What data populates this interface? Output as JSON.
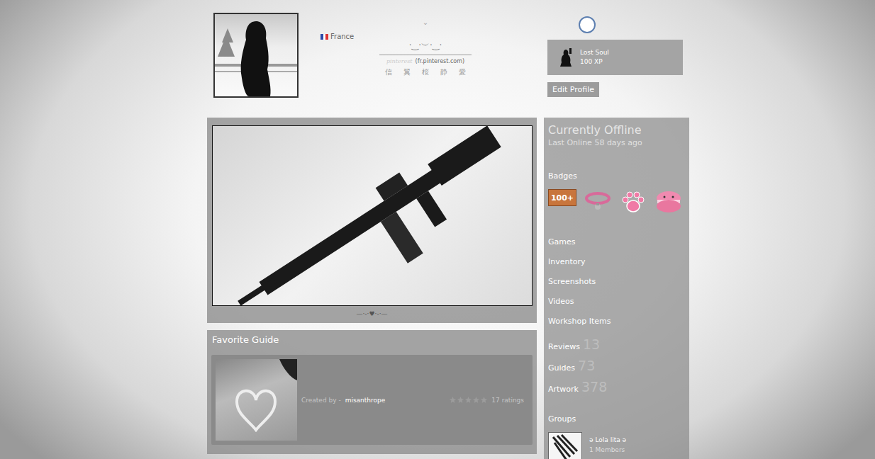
{
  "profile": {
    "country": "France",
    "dropdown_icon": "⌄",
    "decoration": "·‿·︶·‿·",
    "source": "pinterest",
    "source_domain": "(fr.pinterest.com)",
    "kanji": [
      "信",
      "翼",
      "桜",
      "静",
      "愛"
    ]
  },
  "level_badge": {
    "title": "Lost Soul",
    "xp": "100 XP"
  },
  "edit_button": "Edit Profile",
  "showcase": {
    "caption": "—·-·♥·-·—"
  },
  "favorite_guide": {
    "heading": "Favorite Guide",
    "created_by": "Created by -",
    "author": "misanthrope",
    "stars": 0,
    "ratings": "17 ratings"
  },
  "status": {
    "title": "Currently Offline",
    "last_online": "Last Online 58 days ago"
  },
  "badges": {
    "heading": "Badges",
    "items": [
      {
        "kind": "years",
        "label": "100+"
      },
      {
        "kind": "collar"
      },
      {
        "kind": "paw"
      },
      {
        "kind": "macaron"
      }
    ]
  },
  "links": [
    {
      "label": "Games"
    },
    {
      "label": "Inventory"
    },
    {
      "label": "Screenshots"
    },
    {
      "label": "Videos"
    },
    {
      "label": "Workshop Items"
    },
    {
      "label": "Reviews",
      "count": "13"
    },
    {
      "label": "Guides",
      "count": "73"
    },
    {
      "label": "Artwork",
      "count": "378"
    }
  ],
  "groups": {
    "heading": "Groups",
    "items": [
      {
        "name": "ə Lola lita ə",
        "members": "1 Members"
      }
    ]
  }
}
